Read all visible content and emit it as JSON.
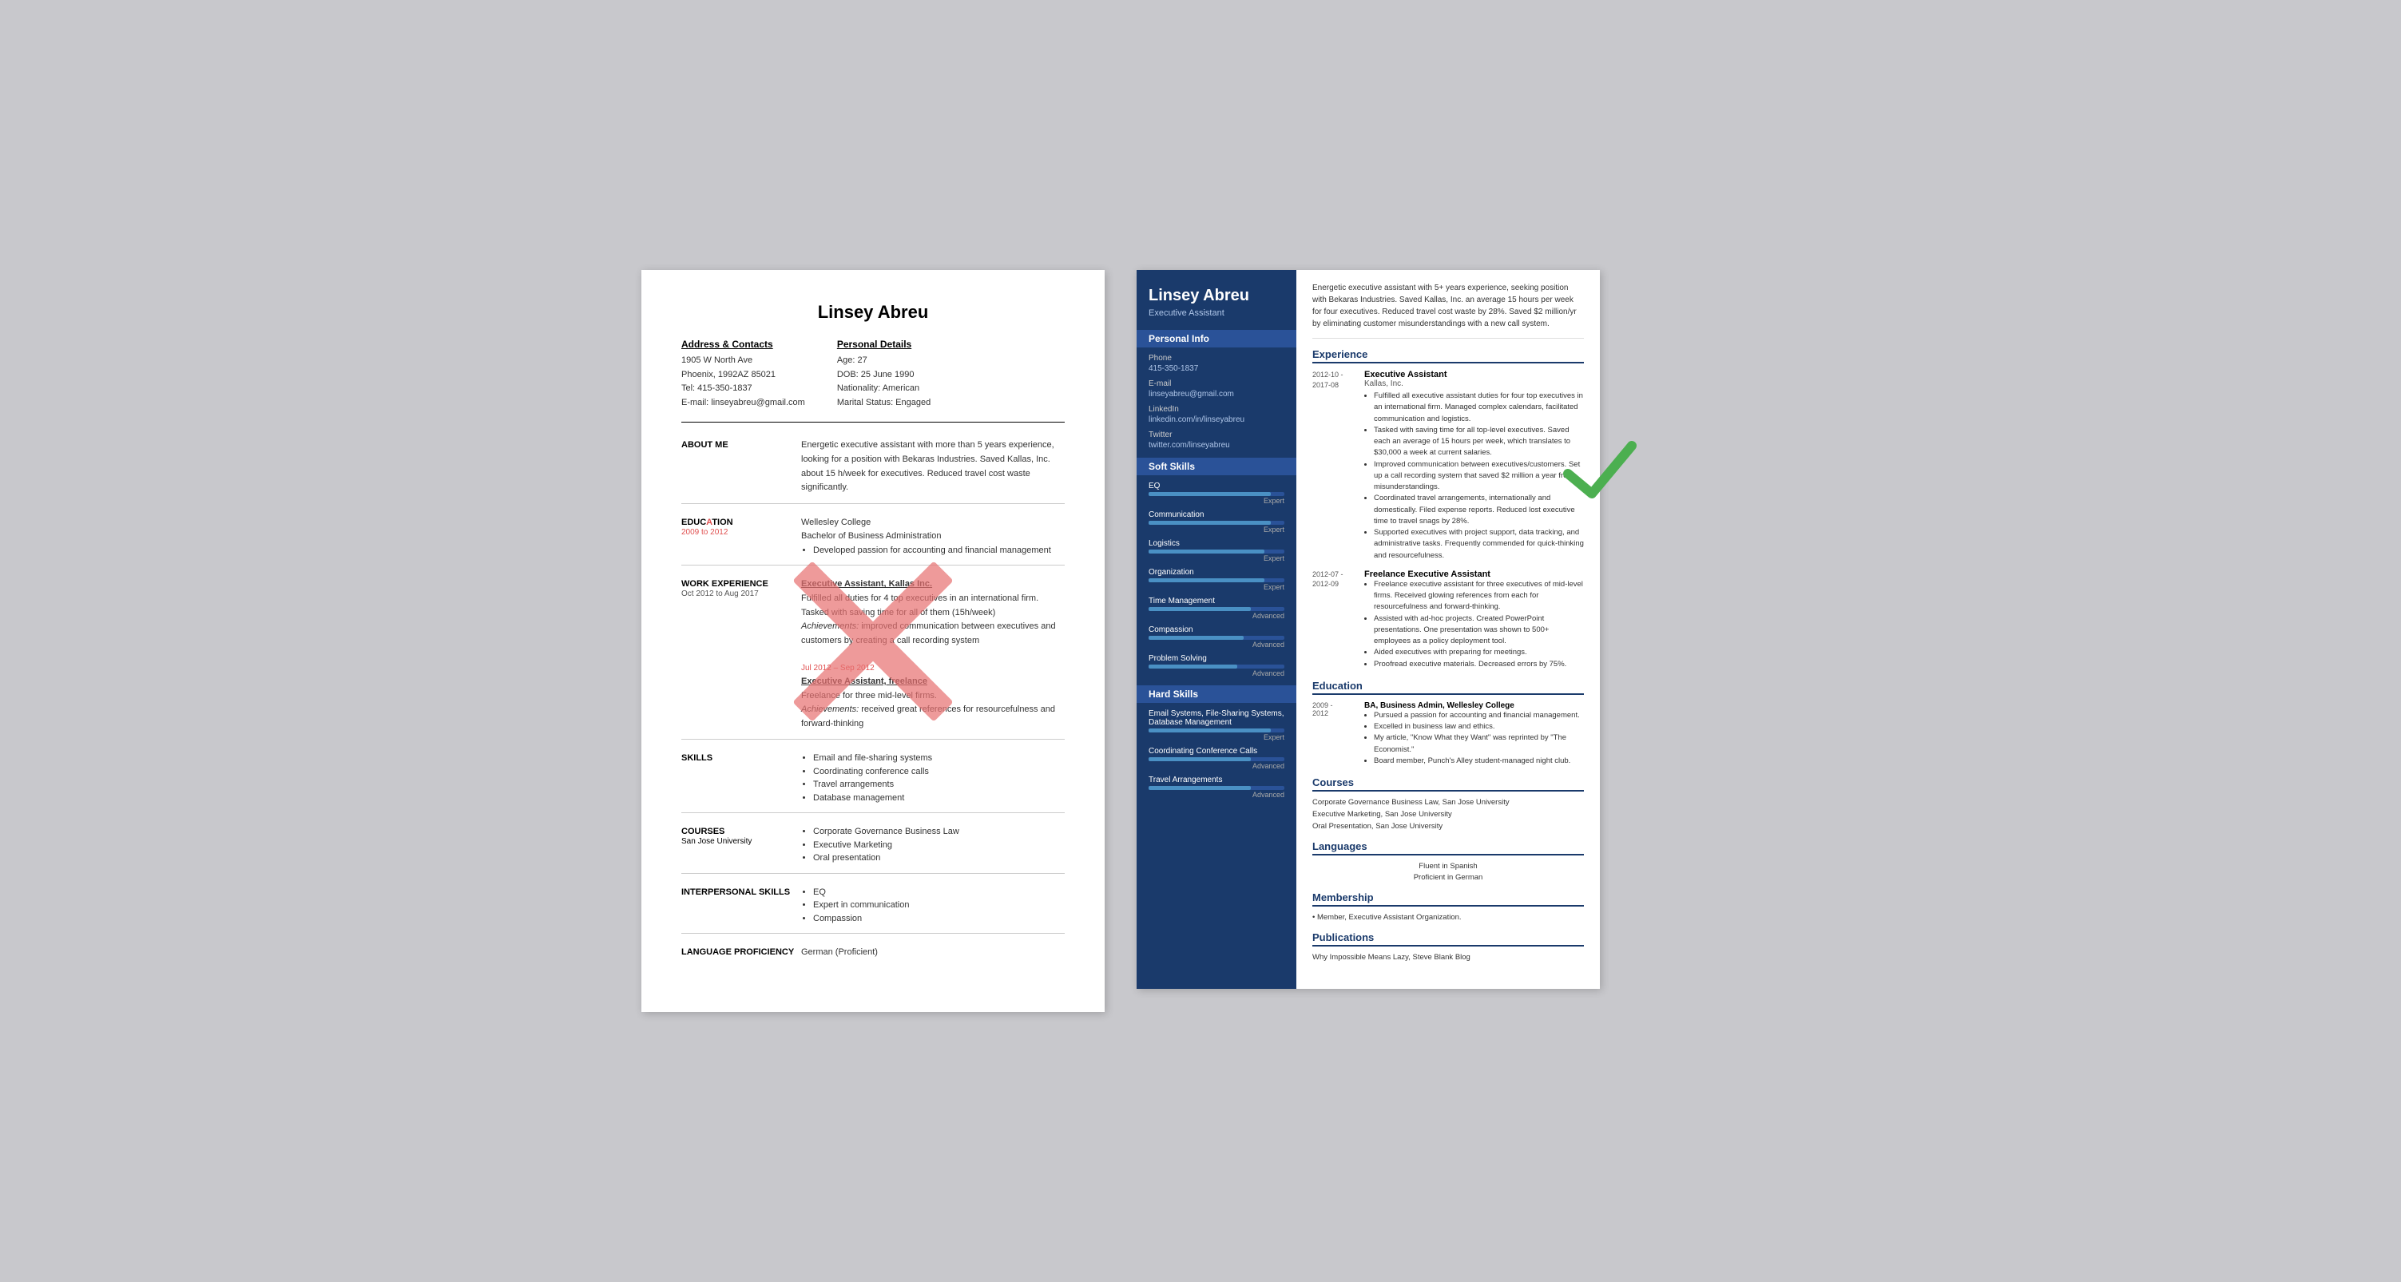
{
  "left_resume": {
    "name": "Linsey Abreu",
    "address_label": "Address & Contacts",
    "address": "1905 W North Ave",
    "city": "Phoenix, 1992AZ 85021",
    "tel": "Tel: 415-350-1837",
    "email": "E-mail: linseyabreu@gmail.com",
    "personal_label": "Personal Details",
    "age": "Age:  27",
    "dob": "DOB:  25 June 1990",
    "nationality": "Nationality: American",
    "marital": "Marital Status: Engaged",
    "about_title": "ABOUT ME",
    "about_content": "Energetic executive assistant with more than 5 years experience, looking for a position with Bekaras Industries. Saved Kallas, Inc. about 15 h/week for executives. Reduced travel cost waste significantly.",
    "education_title": "EDUCATION",
    "education_date": "2009 to 2012",
    "education_school": "Wellesley College",
    "education_degree": "Bachelor of Business Administration",
    "education_bullet": "Developed passion for accounting and financial management",
    "work_title": "WORK EXPERIENCE",
    "work1_date": "Oct 2012 to Aug 2017",
    "work1_jobtitle": "Executive Assistant, Kallas Inc.",
    "work1_desc": "Fulfilled all duties for 4 top executives in an international firm. Tasked with saving time for all of them (15h/week)",
    "work1_achievement_label": "Achievements:",
    "work1_achievement": "improved communication between executives and customers by creating a call recording system",
    "work2_date": "Jul 2012 – Sep 2012",
    "work2_jobtitle": "Executive Assistant, freelance",
    "work2_desc": "Freelance for three mid-level firms.",
    "work2_achievement_label": "Achievements:",
    "work2_achievement": "received great references for resourcefulness and forward-thinking",
    "skills_title": "SKILLS",
    "skills": [
      "Email and file-sharing systems",
      "Coordinating conference calls",
      "Travel arrangements",
      "Database management"
    ],
    "courses_title": "COURSES",
    "courses_sub": "San Jose University",
    "courses": [
      "Corporate Governance Business Law",
      "Executive Marketing",
      "Oral presentation"
    ],
    "interpersonal_title": "INTERPERSONAL SKILLS",
    "interpersonal": [
      "EQ",
      "Expert in communication",
      "Compassion"
    ],
    "language_title": "LANGUAGE PROFICIENCY",
    "language_content": "German (Proficient)"
  },
  "right_resume": {
    "name": "Linsey Abreu",
    "title": "Executive Assistant",
    "summary": "Energetic executive assistant with 5+ years experience, seeking position with Bekaras Industries. Saved Kallas, Inc. an average 15 hours per week for four executives. Reduced travel cost waste by 28%. Saved $2 million/yr by eliminating customer misunderstandings with a new call system.",
    "personal_info_title": "Personal Info",
    "phone_label": "Phone",
    "phone": "415-350-1837",
    "email_label": "E-mail",
    "email": "linseyabreu@gmail.com",
    "linkedin_label": "LinkedIn",
    "linkedin": "linkedin.com/in/linseyabreu",
    "twitter_label": "Twitter",
    "twitter": "twitter.com/linseyabreu",
    "soft_skills_title": "Soft Skills",
    "soft_skills": [
      {
        "name": "EQ",
        "level": 90,
        "label": "Expert"
      },
      {
        "name": "Communication",
        "level": 90,
        "label": "Expert"
      },
      {
        "name": "Logistics",
        "level": 85,
        "label": "Expert"
      },
      {
        "name": "Organization",
        "level": 85,
        "label": "Expert"
      },
      {
        "name": "Time Management",
        "level": 75,
        "label": "Advanced"
      },
      {
        "name": "Compassion",
        "level": 70,
        "label": "Advanced"
      },
      {
        "name": "Problem Solving",
        "level": 65,
        "label": "Advanced"
      }
    ],
    "hard_skills_title": "Hard Skills",
    "hard_skills": [
      {
        "name": "Email Systems, File-Sharing Systems, Database Management",
        "level": 90,
        "label": "Expert"
      },
      {
        "name": "Coordinating Conference Calls",
        "level": 75,
        "label": "Advanced"
      },
      {
        "name": "Travel Arrangements",
        "level": 75,
        "label": "Advanced"
      }
    ],
    "experience_title": "Experience",
    "experience": [
      {
        "date_start": "2012-10 -",
        "date_end": "2017-08",
        "jobtitle": "Executive Assistant",
        "company": "Kallas, Inc.",
        "bullets": [
          "Fulfilled all executive assistant duties for four top executives in an international firm. Managed complex calendars, facilitated communication and logistics.",
          "Tasked with saving time for all top-level executives. Saved each an average of 15 hours per week, which translates to $30,000 a week at current salaries.",
          "Improved communication between executives/customers. Set up a call recording system that saved $2 million a year from misunderstandings.",
          "Coordinated travel arrangements, internationally and domestically. Filed expense reports. Reduced lost executive time to travel snags by 28%.",
          "Supported executives with project support, data tracking, and administrative tasks. Frequently commended for quick-thinking and resourcefulness."
        ]
      },
      {
        "date_start": "2012-07 -",
        "date_end": "2012-09",
        "jobtitle": "Freelance Executive Assistant",
        "company": "",
        "bullets": [
          "Freelance executive assistant for three executives of mid-level firms. Received glowing references from each for resourcefulness and forward-thinking.",
          "Assisted with ad-hoc projects. Created PowerPoint presentations. One presentation was shown to 500+ employees as a policy deployment tool.",
          "Aided executives with preparing for meetings.",
          "Proofread executive materials. Decreased errors by 75%."
        ]
      }
    ],
    "education_title": "Education",
    "education": [
      {
        "date_start": "2009 -",
        "date_end": "2012",
        "degree": "BA, Business Admin, Wellesley College",
        "bullets": [
          "Pursued a passion for accounting and financial management.",
          "Excelled in business law and ethics.",
          "My article, \"Know What they Want\" was reprinted by \"The Economist.\"",
          "Board member, Punch's Alley student-managed night club."
        ]
      }
    ],
    "courses_title": "Courses",
    "courses": [
      "Corporate Governance Business Law, San Jose University",
      "Executive Marketing, San Jose University",
      "Oral Presentation, San Jose University"
    ],
    "languages_title": "Languages",
    "languages": [
      "Fluent in Spanish",
      "Proficient in German"
    ],
    "membership_title": "Membership",
    "membership": [
      "Member, Executive Assistant Organization."
    ],
    "publications_title": "Publications",
    "publications": [
      "Why Impossible Means Lazy, Steve Blank Blog"
    ]
  }
}
